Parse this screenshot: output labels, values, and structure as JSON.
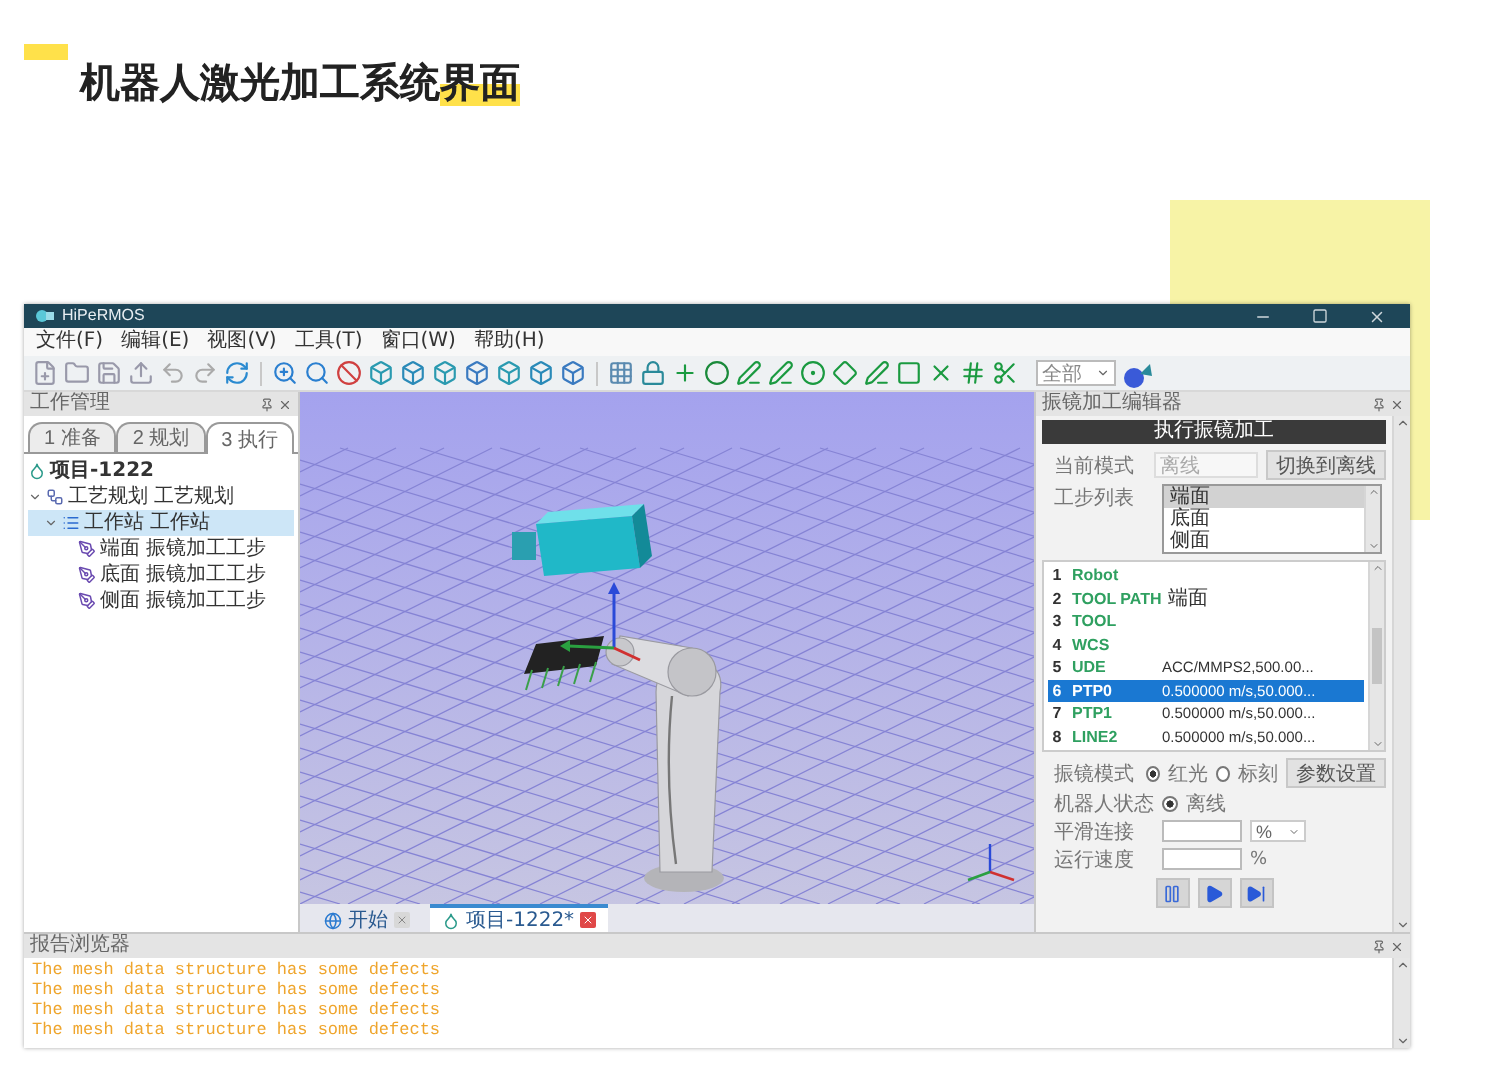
{
  "heading": {
    "text": "机器人激光加工系统",
    "highlight": "界面"
  },
  "window": {
    "title": "HiPeRMOS"
  },
  "menu": [
    "文件(F)",
    "编辑(E)",
    "视图(V)",
    "工具(T)",
    "窗口(W)",
    "帮助(H)"
  ],
  "toolbar": {
    "filter": "全部"
  },
  "work_panel": {
    "title": "工作管理",
    "tabs": [
      {
        "label": "1 准备",
        "selected": false
      },
      {
        "label": "2 规划",
        "selected": false
      },
      {
        "label": "3 执行",
        "selected": true
      }
    ],
    "tree": [
      {
        "kind": "project",
        "label": "项目-1222",
        "selected": false,
        "children": [
          {
            "kind": "process",
            "label": "工艺规划 工艺规划",
            "selected": false,
            "expanded": true,
            "children": [
              {
                "kind": "station",
                "label": "工作站 工作站",
                "selected": true,
                "expanded": true,
                "children": [
                  {
                    "kind": "step",
                    "label": "端面 振镜加工工步",
                    "selected": false
                  },
                  {
                    "kind": "step",
                    "label": "底面 振镜加工工步",
                    "selected": false
                  },
                  {
                    "kind": "step",
                    "label": "侧面 振镜加工工步",
                    "selected": false
                  }
                ]
              }
            ]
          }
        ]
      }
    ]
  },
  "viewport_tabs": [
    {
      "kind": "start",
      "label": "开始",
      "selected": false
    },
    {
      "kind": "project",
      "label": "项目-1222*",
      "selected": true
    }
  ],
  "editor_panel": {
    "title": "振镜加工编辑器",
    "header": "执行振镜加工",
    "mode_label": "当前模式",
    "mode_value": "离线",
    "switch_button": "切换到离线",
    "steps_label": "工步列表",
    "steps": [
      {
        "label": "端面",
        "selected": true
      },
      {
        "label": "底面",
        "selected": false
      },
      {
        "label": "侧面",
        "selected": false
      }
    ],
    "commands": [
      {
        "index": "1",
        "name": "Robot",
        "selected": false
      },
      {
        "index": "2",
        "name": "TOOL PATH",
        "value": "端面",
        "selected": false
      },
      {
        "index": "3",
        "name": "TOOL",
        "selected": false
      },
      {
        "index": "4",
        "name": "WCS",
        "selected": false
      },
      {
        "index": "5",
        "name": "UDE",
        "value": "ACC/MMPS2,500.00...",
        "selected": false
      },
      {
        "index": "6",
        "name": "PTP0",
        "value": "0.500000 m/s,50.000...",
        "selected": true
      },
      {
        "index": "7",
        "name": "PTP1",
        "value": "0.500000 m/s,50.000...",
        "selected": false
      },
      {
        "index": "8",
        "name": "LINE2",
        "value": "0.500000 m/s,50.000...",
        "selected": false
      }
    ],
    "galvo_label": "振镜模式",
    "galvo_modes": [
      {
        "label": "红光",
        "selected": true
      },
      {
        "label": "标刻",
        "selected": false
      }
    ],
    "params_button": "参数设置",
    "robot_label": "机器人状态",
    "robot_states": [
      {
        "label": "离线",
        "selected": true
      }
    ],
    "smoothing_label": "平滑连接",
    "smoothing_unit": "%",
    "speed_label": "运行速度",
    "speed_unit": "%"
  },
  "output": {
    "title": "报告浏览器",
    "lines": [
      "The mesh data structure has some defects",
      "The mesh data structure has some defects",
      "The mesh data structure has some defects",
      "The mesh data structure has some defects"
    ]
  }
}
